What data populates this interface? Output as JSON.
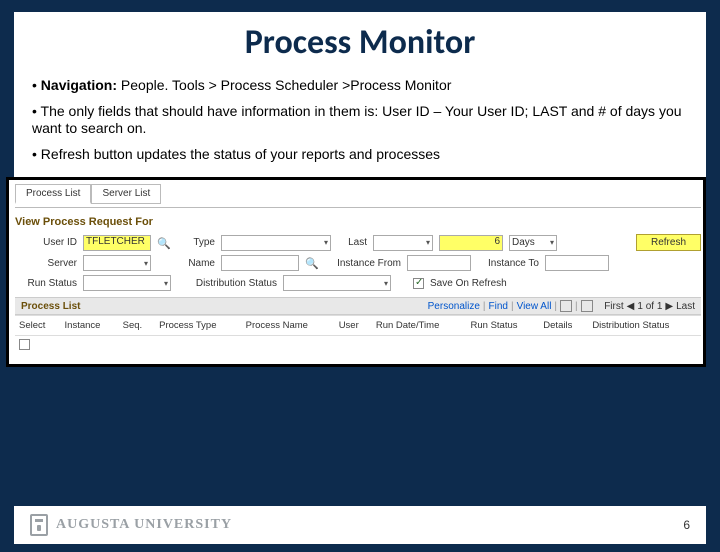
{
  "slide": {
    "title": "Process Monitor",
    "bullets": [
      {
        "label": "Navigation:",
        "text": " People. Tools > Process Scheduler >Process Monitor"
      },
      {
        "label": "",
        "text": "The only fields that should have information in them is: User ID – Your User ID; LAST and # of days you want to search on."
      },
      {
        "label": "",
        "text": "Refresh button updates the status of your reports and processes"
      }
    ],
    "footer": {
      "brand": "AUGUSTA UNIVERSITY",
      "page": "6"
    }
  },
  "app": {
    "tabs": [
      "Process List",
      "Server List"
    ],
    "section_title": "View Process Request For",
    "labels": {
      "user_id": "User ID",
      "type": "Type",
      "last": "Last",
      "server": "Server",
      "name": "Name",
      "instance_from": "Instance From",
      "instance_to": "Instance To",
      "run_status": "Run Status",
      "dist_status": "Distribution Status",
      "save_on_refresh": "Save On Refresh",
      "refresh": "Refresh"
    },
    "fields": {
      "user_id": "TFLETCHER",
      "type": "",
      "last": "",
      "last_n": "6",
      "last_unit": "Days",
      "server": "",
      "name": "",
      "instance_from": "",
      "instance_to": "",
      "run_status": "",
      "dist_status": "",
      "save_on_refresh": true
    },
    "process_list": {
      "header": "Process List",
      "links": {
        "personalize": "Personalize",
        "find": "Find",
        "viewall": "View All"
      },
      "paging": {
        "first": "First",
        "range": "1 of 1",
        "last": "Last"
      },
      "columns": [
        "Select",
        "Instance",
        "Seq.",
        "Process Type",
        "Process Name",
        "User",
        "Run Date/Time",
        "Run Status",
        "Details",
        "Distribution Status"
      ],
      "rows": [
        {
          "select": false,
          "instance": "",
          "seq": "",
          "ptype": "",
          "pname": "",
          "user": "",
          "rundt": "",
          "rstatus": "",
          "details": "",
          "dstatus": ""
        }
      ]
    }
  }
}
